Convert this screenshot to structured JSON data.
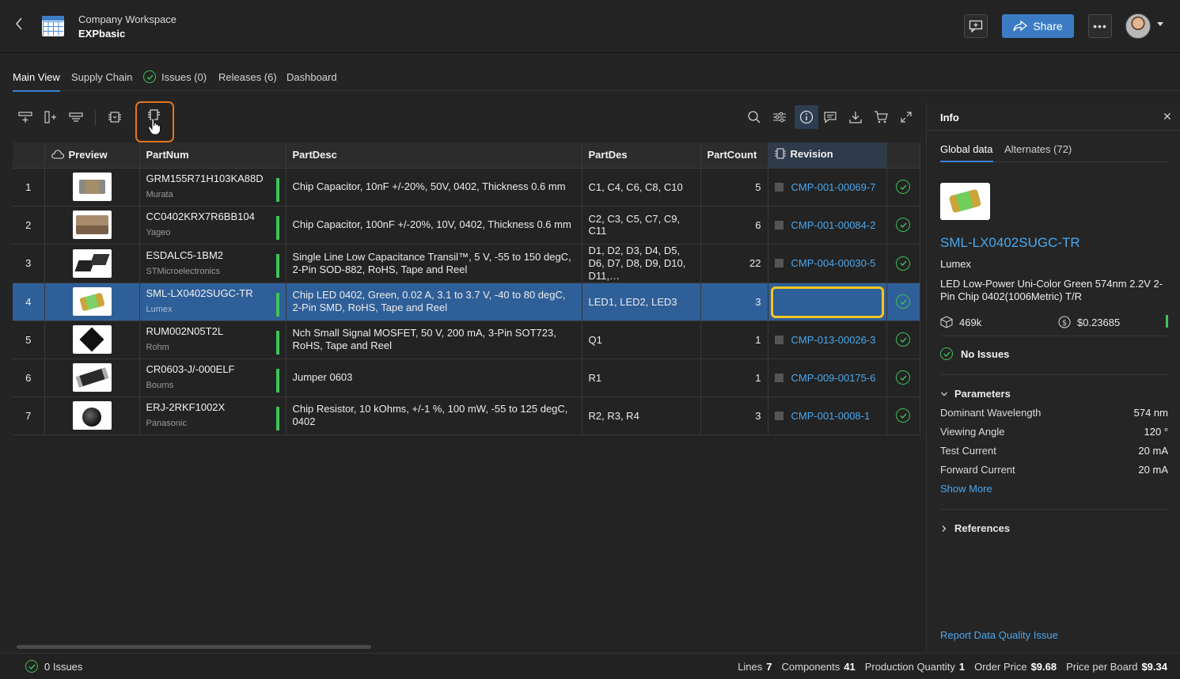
{
  "header": {
    "workspace": "Company Workspace",
    "project": "EXPbasic",
    "share_label": "Share"
  },
  "tabs": [
    {
      "label": "Main View",
      "active": true
    },
    {
      "label": "Supply Chain"
    },
    {
      "label": "Issues (0)",
      "icon": "check-circle-icon"
    },
    {
      "label": "Releases (6)"
    },
    {
      "label": "Dashboard"
    }
  ],
  "table": {
    "columns": [
      "Preview",
      "PartNum",
      "PartDesc",
      "PartDes",
      "PartCount",
      "Revision"
    ],
    "rows": [
      {
        "num": "1",
        "partnum": "GRM155R71H103KA88D",
        "mfr": "Murata",
        "desc": "Chip Capacitor, 10nF +/-20%, 50V, 0402, Thickness 0.6 mm",
        "des": "C1, C4, C6, C8, C10",
        "count": "5",
        "revision": "CMP-001-00069-7"
      },
      {
        "num": "2",
        "partnum": "CC0402KRX7R6BB104",
        "mfr": "Yageo",
        "desc": "Chip Capacitor, 100nF +/-20%, 10V, 0402, Thickness 0.6 mm",
        "des": "C2, C3, C5, C7, C9, C11",
        "count": "6",
        "revision": "CMP-001-00084-2"
      },
      {
        "num": "3",
        "partnum": "ESDALC5-1BM2",
        "mfr": "STMicroelectronics",
        "desc": "Single Line Low Capacitance Transil™, 5 V, -55 to 150 degC, 2-Pin SOD-882, RoHS, Tape and Reel",
        "des": "D1, D2, D3, D4, D5, D6, D7, D8, D9, D10, D11,…",
        "count": "22",
        "revision": "CMP-004-00030-5"
      },
      {
        "num": "4",
        "partnum": "SML-LX0402SUGC-TR",
        "mfr": "Lumex",
        "desc": "Chip LED 0402, Green, 0.02 A, 3.1 to 3.7 V, -40 to 80 degC, 2-Pin SMD, RoHS, Tape and Reel",
        "des": "LED1, LED2, LED3",
        "count": "3",
        "revision": ""
      },
      {
        "num": "5",
        "partnum": "RUM002N05T2L",
        "mfr": "Rohm",
        "desc": "Nch Small Signal MOSFET, 50 V, 200 mA, 3-Pin SOT723, RoHS, Tape and Reel",
        "des": "Q1",
        "count": "1",
        "revision": "CMP-013-00026-3"
      },
      {
        "num": "6",
        "partnum": "CR0603-J/-000ELF",
        "mfr": "Bourns",
        "desc": "Jumper 0603",
        "des": "R1",
        "count": "1",
        "revision": "CMP-009-00175-6"
      },
      {
        "num": "7",
        "partnum": "ERJ-2RKF1002X",
        "mfr": "Panasonic",
        "desc": "Chip Resistor, 10 kOhms, +/-1 %, 100 mW, -55 to 125 degC, 0402",
        "des": "R2, R3, R4",
        "count": "3",
        "revision": "CMP-001-0008-1"
      }
    ]
  },
  "info": {
    "title": "Info",
    "tabs": [
      "Global data",
      "Alternates (72)"
    ],
    "part_name": "SML-LX0402SUGC-TR",
    "manufacturer": "Lumex",
    "description": "LED Low-Power Uni-Color Green 574nm 2.2V 2-Pin Chip 0402(1006Metric) T/R",
    "stock": "469k",
    "price": "$0.23685",
    "issues": "No Issues",
    "parameters_label": "Parameters",
    "parameters": [
      {
        "name": "Dominant Wavelength",
        "value": "574 nm"
      },
      {
        "name": "Viewing Angle",
        "value": "120 °"
      },
      {
        "name": "Test Current",
        "value": "20 mA"
      },
      {
        "name": "Forward Current",
        "value": "20 mA"
      }
    ],
    "show_more": "Show More",
    "references_label": "References",
    "report_link": "Report Data Quality Issue"
  },
  "status": {
    "issues": "0 Issues",
    "lines_label": "Lines",
    "lines": "7",
    "components_label": "Components",
    "components": "41",
    "prodqty_label": "Production Quantity",
    "prodqty": "1",
    "order_label": "Order Price",
    "order": "$9.68",
    "board_label": "Price per Board",
    "board": "$9.34"
  },
  "colors": {
    "accent": "#3b7bc4",
    "selection": "#2f5f98",
    "ok": "#3fbf5a",
    "highlight_orange": "#e3761c",
    "highlight_yellow": "#f3c623"
  }
}
